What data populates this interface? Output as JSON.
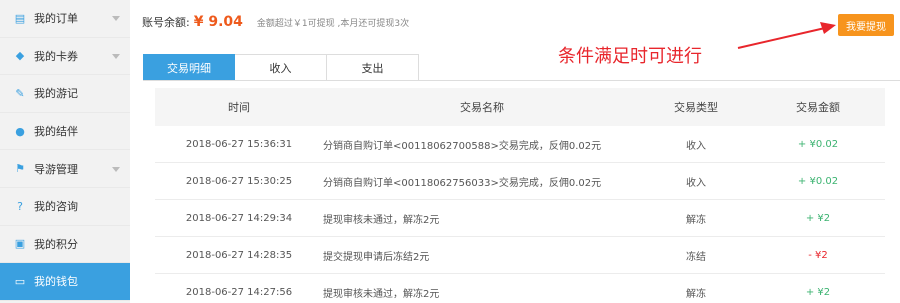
{
  "sidebar": {
    "items": [
      {
        "label": "我的订单",
        "icon": "document-icon",
        "glyph": "▤",
        "has_chevron": true,
        "active": false
      },
      {
        "label": "我的卡券",
        "icon": "tag-icon",
        "glyph": "◆",
        "has_chevron": true,
        "active": false
      },
      {
        "label": "我的游记",
        "icon": "pencil-icon",
        "glyph": "✎",
        "has_chevron": false,
        "active": false
      },
      {
        "label": "我的结伴",
        "icon": "users-icon",
        "glyph": "●",
        "has_chevron": false,
        "active": false
      },
      {
        "label": "导游管理",
        "icon": "flag-icon",
        "glyph": "⚑",
        "has_chevron": true,
        "active": false
      },
      {
        "label": "我的咨询",
        "icon": "question-icon",
        "glyph": "?",
        "has_chevron": false,
        "active": false
      },
      {
        "label": "我的积分",
        "icon": "gift-icon",
        "glyph": "▣",
        "has_chevron": false,
        "active": false
      },
      {
        "label": "我的钱包",
        "icon": "wallet-icon",
        "glyph": "▭",
        "has_chevron": false,
        "active": true
      }
    ]
  },
  "account": {
    "balance_label": "账号余额:",
    "balance_value": "¥ 9.04",
    "note": "金额超过￥1可提现 ,本月还可提现3次"
  },
  "withdraw_button": "我要提现",
  "annotation": "条件满足时可进行",
  "colors": {
    "accent": "#3aa0e0",
    "button": "#f7941d",
    "annotation": "#e8262c",
    "balance": "#ee5a1c",
    "income": "#3cb371",
    "expense": "#e8262c"
  },
  "tabs": [
    {
      "label": "交易明细",
      "active": true
    },
    {
      "label": "收入",
      "active": false
    },
    {
      "label": "支出",
      "active": false
    }
  ],
  "table": {
    "headers": {
      "time": "时间",
      "name": "交易名称",
      "type": "交易类型",
      "amount": "交易金额"
    },
    "rows": [
      {
        "time": "2018-06-27 15:36:31",
        "name": "分销商自购订单<00118062700588>交易完成，反佣0.02元",
        "type": "收入",
        "amount": "+ ¥0.02",
        "sign": "plus"
      },
      {
        "time": "2018-06-27 15:30:25",
        "name": "分销商自购订单<00118062756033>交易完成，反佣0.02元",
        "type": "收入",
        "amount": "+ ¥0.02",
        "sign": "plus"
      },
      {
        "time": "2018-06-27 14:29:34",
        "name": "提现审核未通过，解冻2元",
        "type": "解冻",
        "amount": "+ ¥2",
        "sign": "plus"
      },
      {
        "time": "2018-06-27 14:28:35",
        "name": "提交提现申请后冻结2元",
        "type": "冻结",
        "amount": "- ¥2",
        "sign": "minus"
      },
      {
        "time": "2018-06-27 14:27:56",
        "name": "提现审核未通过，解冻2元",
        "type": "解冻",
        "amount": "+ ¥2",
        "sign": "plus"
      }
    ]
  }
}
